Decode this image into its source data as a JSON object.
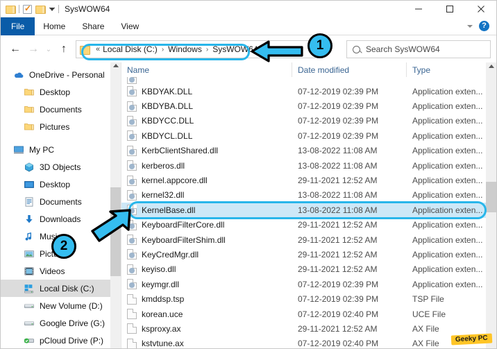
{
  "window": {
    "title": "SysWOW64",
    "quick_access": [
      {
        "name": "folder-icon",
        "label": "Folder"
      },
      {
        "name": "properties-icon",
        "label": "Properties"
      },
      {
        "name": "new-folder-icon",
        "label": "New folder"
      },
      {
        "name": "customize-caret-icon",
        "label": "Customize Quick Access Toolbar"
      }
    ],
    "controls": {
      "minimize": "Minimize",
      "maximize": "Maximize",
      "close": "Close"
    }
  },
  "ribbon": {
    "tabs": [
      {
        "label": "File"
      },
      {
        "label": "Home"
      },
      {
        "label": "Share"
      },
      {
        "label": "View"
      }
    ],
    "expand_label": "Expand the Ribbon",
    "help_label": "?"
  },
  "navbar": {
    "back": "←",
    "forward": "→",
    "recent": "⌄",
    "up": "↑",
    "breadcrumb": {
      "lead": "«",
      "separator": "›",
      "items": [
        "Local Disk (C:)",
        "Windows",
        "SysWOW64"
      ]
    }
  },
  "search": {
    "placeholder": "Search SysWOW64",
    "value": "",
    "icon": "search-icon"
  },
  "sidebar": {
    "groups": [
      {
        "items": [
          {
            "label": "OneDrive - Personal",
            "icon": "onedrive-cloud-icon",
            "indent": false,
            "selected": false
          },
          {
            "label": "Desktop",
            "icon": "folder-icon",
            "indent": true,
            "selected": false
          },
          {
            "label": "Documents",
            "icon": "folder-icon",
            "indent": true,
            "selected": false
          },
          {
            "label": "Pictures",
            "icon": "folder-icon",
            "indent": true,
            "selected": false
          }
        ]
      },
      {
        "items": [
          {
            "label": "My PC",
            "icon": "this-pc-icon",
            "indent": false,
            "selected": false
          },
          {
            "label": "3D Objects",
            "icon": "3d-objects-icon",
            "indent": true,
            "selected": false
          },
          {
            "label": "Desktop",
            "icon": "desktop-icon",
            "indent": true,
            "selected": false
          },
          {
            "label": "Documents",
            "icon": "documents-icon",
            "indent": true,
            "selected": false
          },
          {
            "label": "Downloads",
            "icon": "downloads-icon",
            "indent": true,
            "selected": false
          },
          {
            "label": "Music",
            "icon": "music-icon",
            "indent": true,
            "selected": false
          },
          {
            "label": "Pictures",
            "icon": "pictures-icon",
            "indent": true,
            "selected": false
          },
          {
            "label": "Videos",
            "icon": "videos-icon",
            "indent": true,
            "selected": false
          },
          {
            "label": "Local Disk (C:)",
            "icon": "local-disk-icon",
            "indent": true,
            "selected": true
          },
          {
            "label": "New Volume (D:)",
            "icon": "drive-icon",
            "indent": true,
            "selected": false
          },
          {
            "label": "Google Drive (G:)",
            "icon": "drive-icon",
            "indent": true,
            "selected": false
          },
          {
            "label": "pCloud Drive (P:)",
            "icon": "pcloud-drive-icon",
            "indent": true,
            "selected": false
          }
        ]
      }
    ]
  },
  "filelist": {
    "columns": [
      {
        "key": "name",
        "label": "Name",
        "sorted": "asc"
      },
      {
        "key": "date",
        "label": "Date modified",
        "sorted": null
      },
      {
        "key": "type",
        "label": "Type",
        "sorted": null
      }
    ],
    "rows": [
      {
        "name": "KBDYAK.DLL",
        "date": "07-12-2019 02:39 PM",
        "type": "Application exten...",
        "icon": "dll-file-icon",
        "selected": false
      },
      {
        "name": "KBDYBA.DLL",
        "date": "07-12-2019 02:39 PM",
        "type": "Application exten...",
        "icon": "dll-file-icon",
        "selected": false
      },
      {
        "name": "KBDYCC.DLL",
        "date": "07-12-2019 02:39 PM",
        "type": "Application exten...",
        "icon": "dll-file-icon",
        "selected": false
      },
      {
        "name": "KBDYCL.DLL",
        "date": "07-12-2019 02:39 PM",
        "type": "Application exten...",
        "icon": "dll-file-icon",
        "selected": false
      },
      {
        "name": "KerbClientShared.dll",
        "date": "13-08-2022 11:08 AM",
        "type": "Application exten...",
        "icon": "dll-file-icon",
        "selected": false
      },
      {
        "name": "kerberos.dll",
        "date": "13-08-2022 11:08 AM",
        "type": "Application exten...",
        "icon": "dll-file-icon",
        "selected": false
      },
      {
        "name": "kernel.appcore.dll",
        "date": "29-11-2021 12:52 AM",
        "type": "Application exten...",
        "icon": "dll-file-icon",
        "selected": false
      },
      {
        "name": "kernel32.dll",
        "date": "13-08-2022 11:08 AM",
        "type": "Application exten...",
        "icon": "dll-file-icon",
        "selected": false
      },
      {
        "name": "KernelBase.dll",
        "date": "13-08-2022 11:08 AM",
        "type": "Application exten...",
        "icon": "dll-file-icon",
        "selected": true
      },
      {
        "name": "KeyboardFilterCore.dll",
        "date": "29-11-2021 12:52 AM",
        "type": "Application exten...",
        "icon": "dll-file-icon",
        "selected": false
      },
      {
        "name": "KeyboardFilterShim.dll",
        "date": "29-11-2021 12:52 AM",
        "type": "Application exten...",
        "icon": "dll-file-icon",
        "selected": false
      },
      {
        "name": "KeyCredMgr.dll",
        "date": "29-11-2021 12:52 AM",
        "type": "Application exten...",
        "icon": "dll-file-icon",
        "selected": false
      },
      {
        "name": "keyiso.dll",
        "date": "29-11-2021 12:52 AM",
        "type": "Application exten...",
        "icon": "dll-file-icon",
        "selected": false
      },
      {
        "name": "keymgr.dll",
        "date": "07-12-2019 02:39 PM",
        "type": "Application exten...",
        "icon": "dll-file-icon",
        "selected": false
      },
      {
        "name": "kmddsp.tsp",
        "date": "07-12-2019 02:39 PM",
        "type": "TSP File",
        "icon": "generic-file-icon",
        "selected": false
      },
      {
        "name": "korean.uce",
        "date": "07-12-2019 02:40 PM",
        "type": "UCE File",
        "icon": "generic-file-icon",
        "selected": false
      },
      {
        "name": "ksproxy.ax",
        "date": "29-11-2021 12:52 AM",
        "type": "AX File",
        "icon": "generic-file-icon",
        "selected": false
      },
      {
        "name": "kstvtune.ax",
        "date": "07-12-2019 02:40 PM",
        "type": "AX File",
        "icon": "generic-file-icon",
        "selected": false
      }
    ]
  },
  "annotations": {
    "badge_one": "1",
    "badge_two": "2",
    "accent_color": "#35bdf0",
    "highlight_address_bar": true,
    "highlight_selected_row": true
  },
  "watermark": {
    "text": "Geeky PC",
    "background": "#ffc527"
  }
}
